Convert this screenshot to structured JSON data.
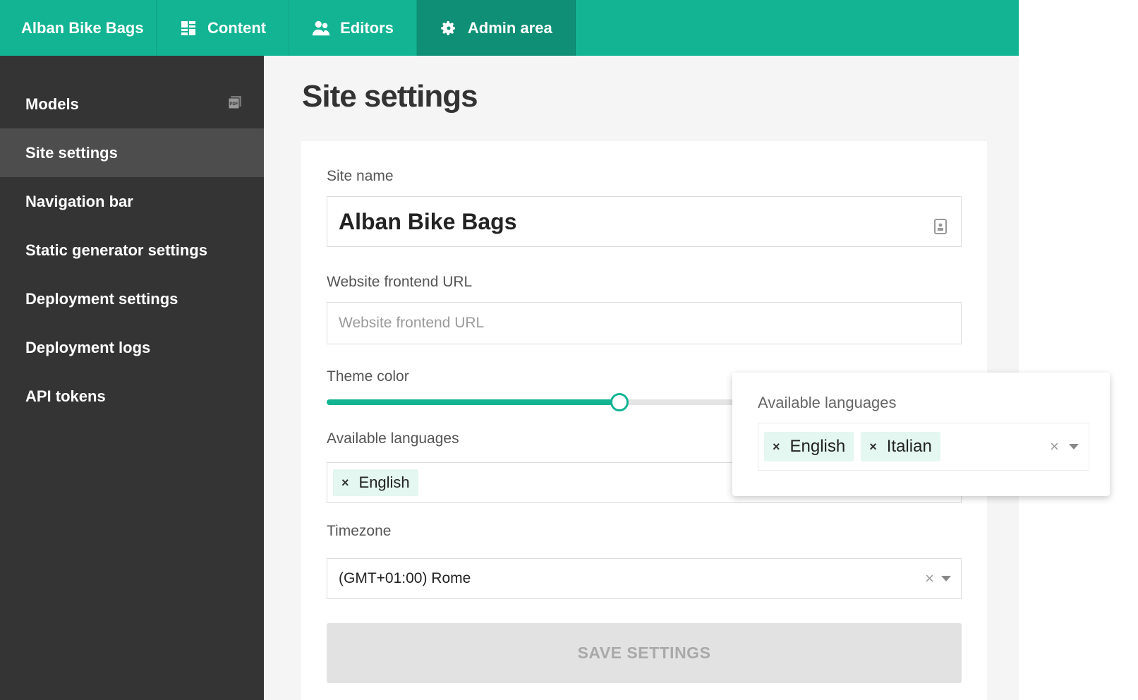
{
  "topbar": {
    "brand": "Alban Bike Bags",
    "tabs": [
      {
        "label": "Content",
        "icon": "grid-icon"
      },
      {
        "label": "Editors",
        "icon": "users-icon"
      },
      {
        "label": "Admin area",
        "icon": "gear-icon",
        "active": true
      }
    ]
  },
  "sidebar": {
    "items": [
      {
        "label": "Models",
        "icon": "pdf-icon"
      },
      {
        "label": "Site settings",
        "active": true
      },
      {
        "label": "Navigation bar"
      },
      {
        "label": "Static generator settings"
      },
      {
        "label": "Deployment settings"
      },
      {
        "label": "Deployment logs"
      },
      {
        "label": "API tokens"
      }
    ]
  },
  "main": {
    "title": "Site settings",
    "site_name": {
      "label": "Site name",
      "value": "Alban Bike Bags"
    },
    "frontend_url": {
      "label": "Website frontend URL",
      "value": "",
      "placeholder": "Website frontend URL"
    },
    "theme_color": {
      "label": "Theme color",
      "value_percent": 46,
      "color": "#13b493"
    },
    "languages": {
      "label": "Available languages",
      "selected": [
        "English"
      ]
    },
    "timezone": {
      "label": "Timezone",
      "value": "(GMT+01:00) Rome"
    },
    "save_label": "SAVE SETTINGS"
  },
  "popout": {
    "label": "Available languages",
    "selected": [
      "English",
      "Italian"
    ]
  },
  "colors": {
    "accent": "#13b493",
    "accent_dark": "#0f8f75",
    "sidebar": "#343434",
    "sidebar_active": "#4d4d4d"
  }
}
